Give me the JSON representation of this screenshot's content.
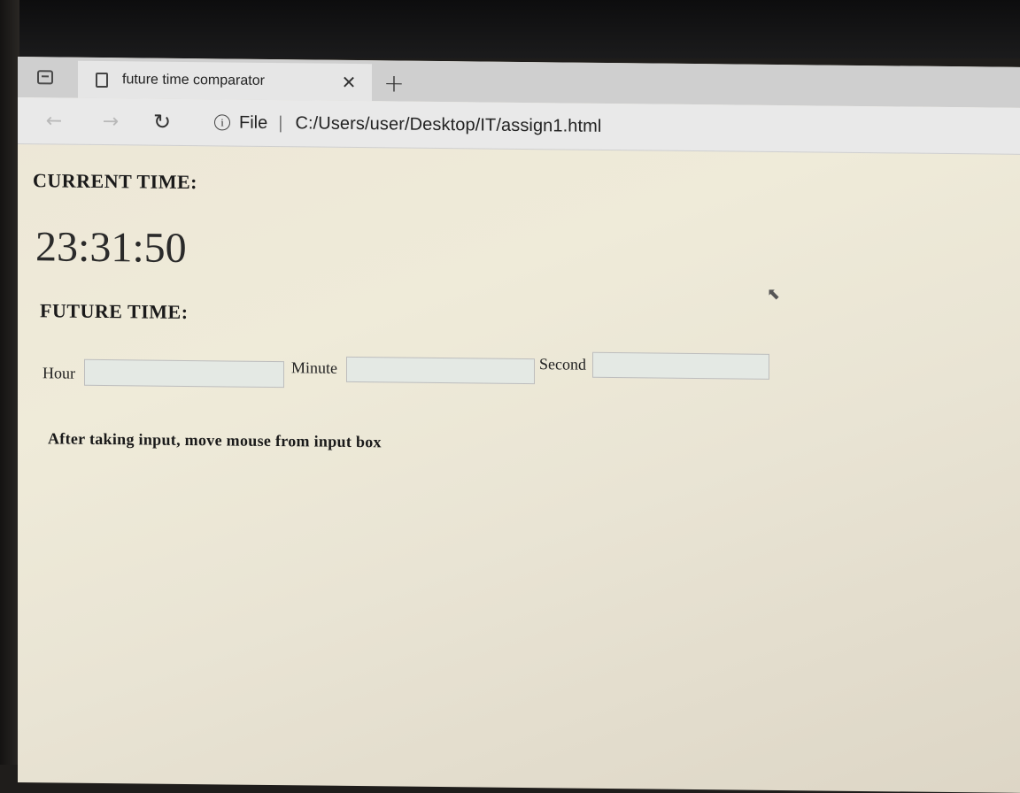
{
  "browser": {
    "tab": {
      "title": "future time comparator"
    },
    "address": {
      "site_label": "File",
      "url": "C:/Users/user/Desktop/IT/assign1.html"
    }
  },
  "page": {
    "current_time_label": "CURRENT TIME:",
    "current_time_value": "23:31:50",
    "future_time_label": "FUTURE TIME:",
    "fields": {
      "hour_label": "Hour",
      "hour_value": "",
      "minute_label": "Minute",
      "minute_value": "",
      "second_label": "Second",
      "second_value": ""
    },
    "hint": "After taking input, move mouse from input box"
  }
}
